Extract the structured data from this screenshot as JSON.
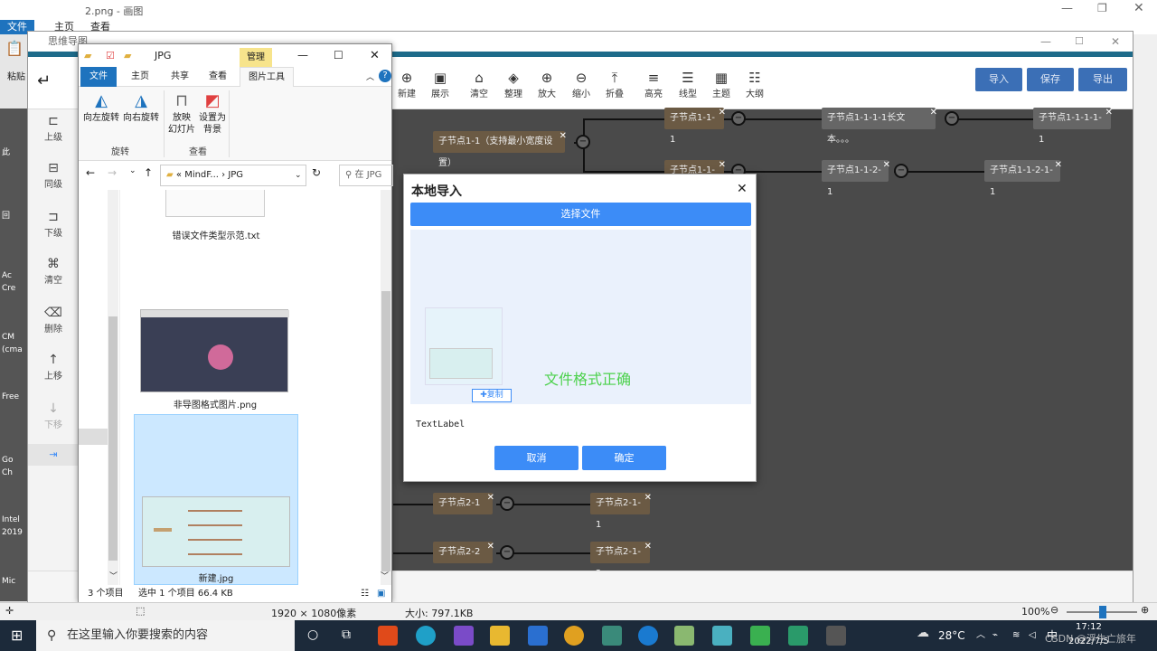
{
  "paint": {
    "title": "2.png - 画图",
    "tabs": [
      "文件",
      "主页",
      "查看"
    ],
    "paste_label": "粘贴",
    "status_dimensions": "1920 × 1080像素",
    "status_size": "大小: 797.1KB",
    "zoom": "100%"
  },
  "desktop_left": [
    "此",
    "回",
    "Ac",
    "Cre",
    "CM",
    "(cma",
    "Free",
    "Go",
    "Ch",
    "Intel",
    "2019",
    "Mic"
  ],
  "mindmap": {
    "title": "思维导图",
    "toolbar": [
      "新建",
      "展示",
      "清空",
      "整理",
      "放大",
      "缩小",
      "折叠",
      "高亮",
      "线型",
      "主题",
      "大纲"
    ],
    "actions": [
      "导入",
      "保存",
      "导出"
    ],
    "sidebar": [
      "上级",
      "同级",
      "下级",
      "清空",
      "删除",
      "上移",
      "下移"
    ],
    "nodes": {
      "n1": "子节点1-1（支持最小宽度设置）",
      "n11": "子节点1-1-1",
      "n111": "子节点1-1-1-1长文本。。。",
      "n1111": "子节点1-1-1-1-1",
      "n12": "子节点1-1-2",
      "n121": "子节点1-1-2-1",
      "n1211": "子节点1-1-2-1-1",
      "n21": "子节点2-1",
      "n211": "子节点2-1-1",
      "n22": "子节点2-2",
      "n221": "子节点2-1-2"
    }
  },
  "explorer": {
    "title": "JPG",
    "manage_tab": "管理",
    "ribbon_tabs": [
      "文件",
      "主页",
      "共享",
      "查看",
      "图片工具"
    ],
    "ribbon": {
      "rotate_left": "向左旋转",
      "rotate_right": "向右旋转",
      "group_rotate": "旋转",
      "slideshow": "放映\n幻灯片",
      "set_bg": "设置为\n背景",
      "group_view": "查看"
    },
    "address": [
      "MindF...",
      "JPG"
    ],
    "search_placeholder": "在 JPG",
    "files": [
      "错误文件类型示范.txt",
      "非导图格式图片.png",
      "新建.jpg"
    ],
    "status_count": "3 个项目",
    "status_selected": "选中 1 个项目  66.4 KB"
  },
  "dialog": {
    "title": "本地导入",
    "pick_file": "选择文件",
    "result": "文件格式正确",
    "copy_badge": "复制",
    "text_label": "TextLabel",
    "cancel": "取消",
    "confirm": "确定"
  },
  "taskbar": {
    "search": "在这里输入你要搜索的内容",
    "temperature": "28°C",
    "ime": "中",
    "time": "17:12",
    "date": "2022/7/5",
    "watermark": "CSDN @浮生亡旅年"
  },
  "colors": {
    "accent": "#3c8cf7",
    "canvas_bg": "#4a4a4a",
    "node_brown": "#6b5a44",
    "node_grey": "#666666",
    "ok_text": "#4cd14c",
    "manage_tab": "#f7e48c"
  }
}
